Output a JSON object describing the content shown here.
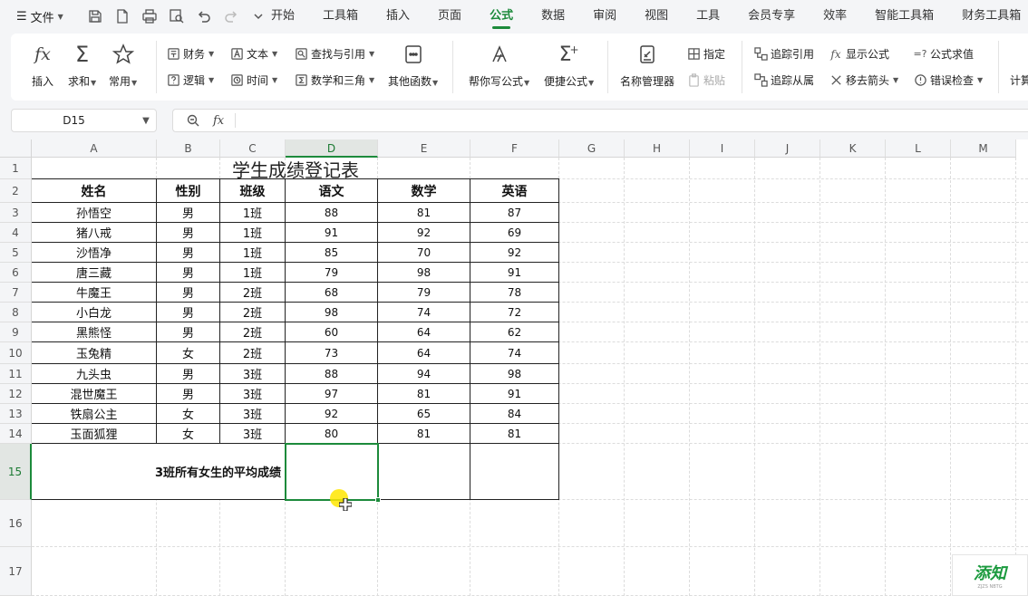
{
  "menubar": {
    "file_label": "文件",
    "tabs": [
      "开始",
      "工具箱",
      "插入",
      "页面",
      "公式",
      "数据",
      "审阅",
      "视图",
      "工具",
      "会员专享",
      "效率",
      "智能工具箱",
      "财务工具箱"
    ],
    "active_tab": "公式"
  },
  "ribbon": {
    "insert": "插入",
    "sum": "求和",
    "common": "常用",
    "finance": "财务",
    "logic": "逻辑",
    "text": "文本",
    "time": "时间",
    "lookup": "查找与引用",
    "math": "数学和三角",
    "other": "其他函数",
    "help_write": "帮你写公式",
    "quick_formula": "便捷公式",
    "name_manager": "名称管理器",
    "define": "指定",
    "paste": "粘贴",
    "trace_precedents": "追踪引用",
    "trace_dependents": "追踪从属",
    "show_formulas": "显示公式",
    "remove_arrows": "移去箭头",
    "evaluate": "公式求值",
    "error_check": "错误检查",
    "calc": "计算"
  },
  "formula_bar": {
    "name_box": "D15",
    "fx": "fx",
    "value": ""
  },
  "sheet": {
    "columns": [
      "A",
      "B",
      "C",
      "D",
      "E",
      "F",
      "G",
      "H",
      "I",
      "J",
      "K",
      "L",
      "M"
    ],
    "rows": [
      "1",
      "2",
      "3",
      "4",
      "5",
      "6",
      "7",
      "8",
      "9",
      "10",
      "11",
      "12",
      "13",
      "14",
      "15",
      "16",
      "17"
    ],
    "selected_col": "D",
    "selected_row": "15",
    "title": "学生成绩登记表",
    "headers": [
      "姓名",
      "性别",
      "班级",
      "语文",
      "数学",
      "英语"
    ],
    "records": [
      [
        "孙悟空",
        "男",
        "1班",
        "88",
        "81",
        "87"
      ],
      [
        "猪八戒",
        "男",
        "1班",
        "91",
        "92",
        "69"
      ],
      [
        "沙悟净",
        "男",
        "1班",
        "85",
        "70",
        "92"
      ],
      [
        "唐三藏",
        "男",
        "1班",
        "79",
        "98",
        "91"
      ],
      [
        "牛魔王",
        "男",
        "2班",
        "68",
        "79",
        "78"
      ],
      [
        "小白龙",
        "男",
        "2班",
        "98",
        "74",
        "72"
      ],
      [
        "黑熊怪",
        "男",
        "2班",
        "60",
        "64",
        "62"
      ],
      [
        "玉兔精",
        "女",
        "2班",
        "73",
        "64",
        "74"
      ],
      [
        "九头虫",
        "男",
        "3班",
        "88",
        "94",
        "98"
      ],
      [
        "混世魔王",
        "男",
        "3班",
        "97",
        "81",
        "91"
      ],
      [
        "铁扇公主",
        "女",
        "3班",
        "92",
        "65",
        "84"
      ],
      [
        "玉面狐狸",
        "女",
        "3班",
        "80",
        "81",
        "81"
      ]
    ],
    "summary_label": "3班所有女生的平均成绩"
  },
  "watermark": {
    "text": "添知",
    "sub": "ZJZS NBTG"
  }
}
